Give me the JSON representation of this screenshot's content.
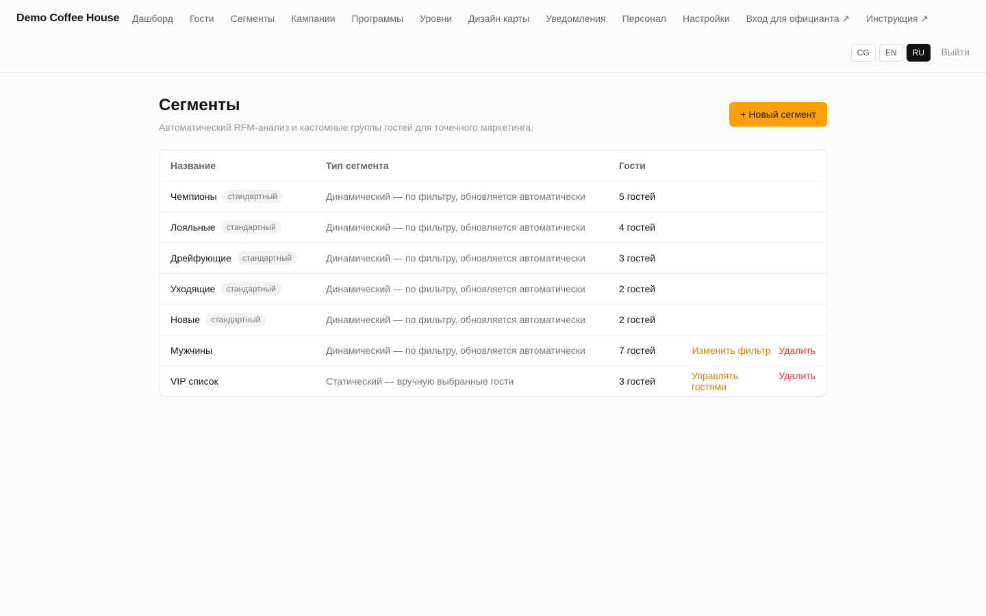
{
  "header": {
    "brand": "Demo Coffee House",
    "nav": [
      "Дашборд",
      "Гости",
      "Сегменты",
      "Кампании",
      "Программы",
      "Уровни",
      "Дизайн карты",
      "Уведомления",
      "Персонал",
      "Настройки",
      "Вход для официанта ↗",
      "Инструкция ↗"
    ],
    "languages": [
      "CG",
      "EN",
      "RU"
    ],
    "active_language": "RU",
    "logout": "Выйти"
  },
  "page": {
    "title": "Сегменты",
    "subtitle": "Автоматический RFM-анализ и кастомные группы гостей для точечного маркетинга.",
    "new_button": "+ Новый сегмент"
  },
  "table": {
    "headers": [
      "Название",
      "Тип сегмента",
      "Гости"
    ],
    "rows": [
      {
        "name": "Чемпионы",
        "badge": "стандартный",
        "type": "Динамический — по фильтру, обновляется автоматически",
        "guests": "5 гостей",
        "action1": "",
        "action2": ""
      },
      {
        "name": "Лояльные",
        "badge": "стандартный",
        "type": "Динамический — по фильтру, обновляется автоматически",
        "guests": "4 гостей",
        "action1": "",
        "action2": ""
      },
      {
        "name": "Дрейфующие",
        "badge": "стандартный",
        "type": "Динамический — по фильтру, обновляется автоматически",
        "guests": "3 гостей",
        "action1": "",
        "action2": ""
      },
      {
        "name": "Уходящие",
        "badge": "стандартный",
        "type": "Динамический — по фильтру, обновляется автоматически",
        "guests": "2 гостей",
        "action1": "",
        "action2": ""
      },
      {
        "name": "Новые",
        "badge": "стандартный",
        "type": "Динамический — по фильтру, обновляется автоматически",
        "guests": "2 гостей",
        "action1": "",
        "action2": ""
      },
      {
        "name": "Мужчины",
        "badge": "",
        "type": "Динамический — по фильтру, обновляется автоматически",
        "guests": "7 гостей",
        "action1": "Изменить фильтр",
        "action2": "Удалить"
      },
      {
        "name": "VIP список",
        "badge": "",
        "type": "Статический — вручную выбранные гости",
        "guests": "3 гостей",
        "action1": "Управлять гостями",
        "action2": "Удалить"
      }
    ]
  },
  "colors": {
    "accent": "#ff9f0a",
    "action_edit": "#e07a10",
    "action_delete": "#e5352e"
  }
}
